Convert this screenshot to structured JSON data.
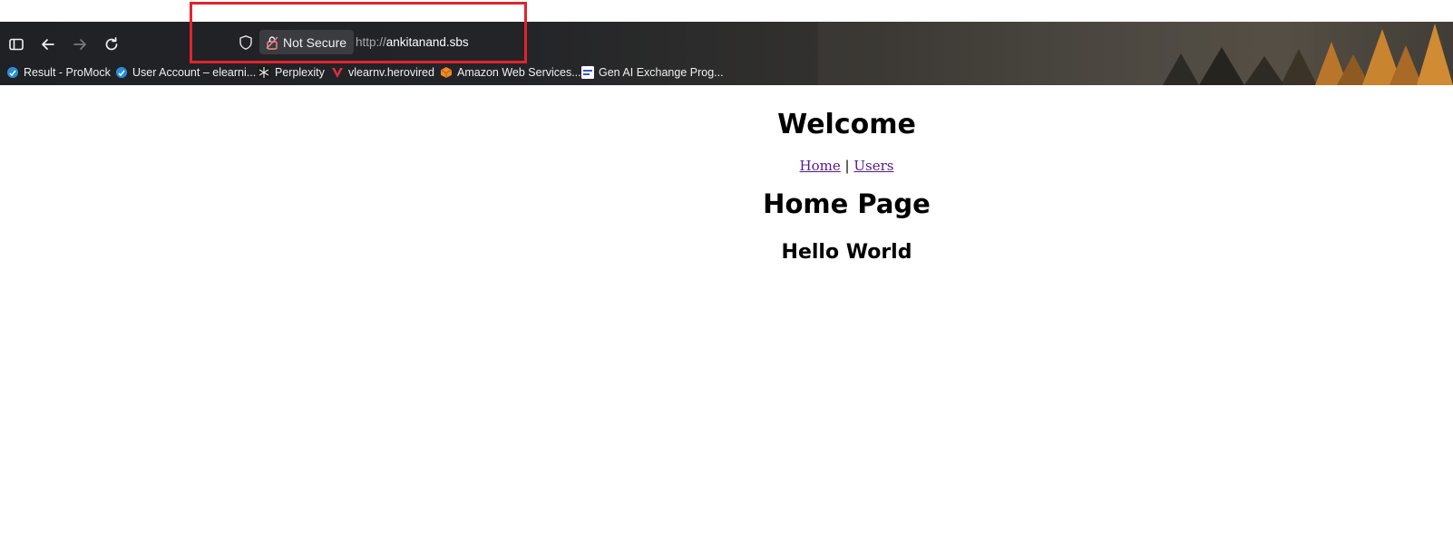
{
  "browser": {
    "security_label": "Not Secure",
    "url_protocol": "http://",
    "url_host": "ankitanand.sbs",
    "bookmarks": [
      {
        "label": "Result - ProMock",
        "icon": "promock-icon"
      },
      {
        "label": "User Account – elearni...",
        "icon": "promock-icon"
      },
      {
        "label": "Perplexity",
        "icon": "perplexity-icon"
      },
      {
        "label": "vlearnv.herovired",
        "icon": "herovired-icon"
      },
      {
        "label": "Amazon Web Services...",
        "icon": "aws-icon"
      },
      {
        "label": "Gen AI Exchange Prog...",
        "icon": "genai-icon"
      }
    ]
  },
  "page": {
    "heading": "Welcome",
    "nav_home": "Home",
    "nav_separator": "|",
    "nav_users": "Users",
    "page_title": "Home Page",
    "greeting": "Hello World"
  },
  "colors": {
    "highlight_box": "#e0242b",
    "visited_link": "#551a8b"
  }
}
